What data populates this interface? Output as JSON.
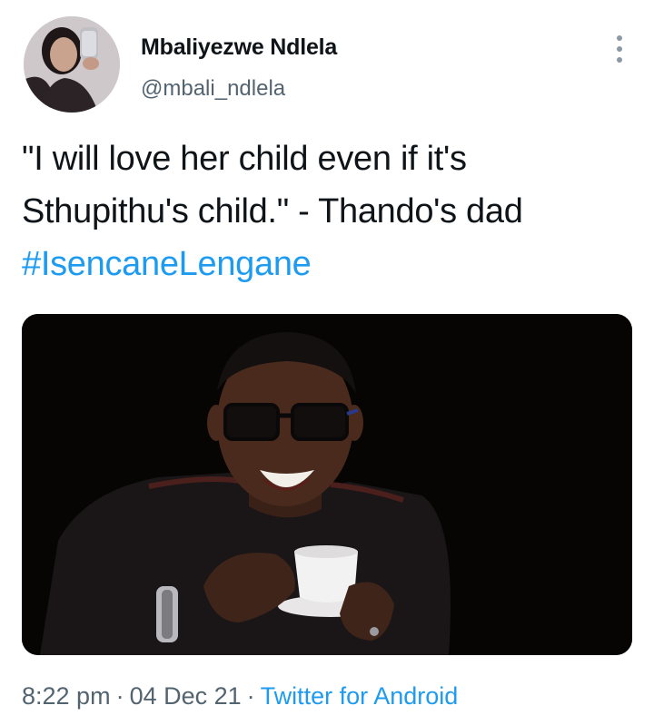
{
  "author": {
    "display_name": "Mbaliyezwe Ndlela",
    "handle": "@mbali_ndlela",
    "avatar_icon": "profile-avatar"
  },
  "more_icon": "more-options-icon",
  "tweet": {
    "text_line1": "\"I will love her child even if it's",
    "text_line2": "Sthupithu's child.\" - Thando's dad",
    "hashtag": "#IsencaneLengane"
  },
  "media": {
    "kind": "image"
  },
  "meta": {
    "time": "8:22 pm",
    "separator1": "·",
    "date": "04 Dec 21",
    "separator2": "·",
    "source": "Twitter for Android"
  },
  "colors": {
    "link": "#1d9bf0",
    "secondary_text": "#536471",
    "primary_text": "#0f1419"
  }
}
